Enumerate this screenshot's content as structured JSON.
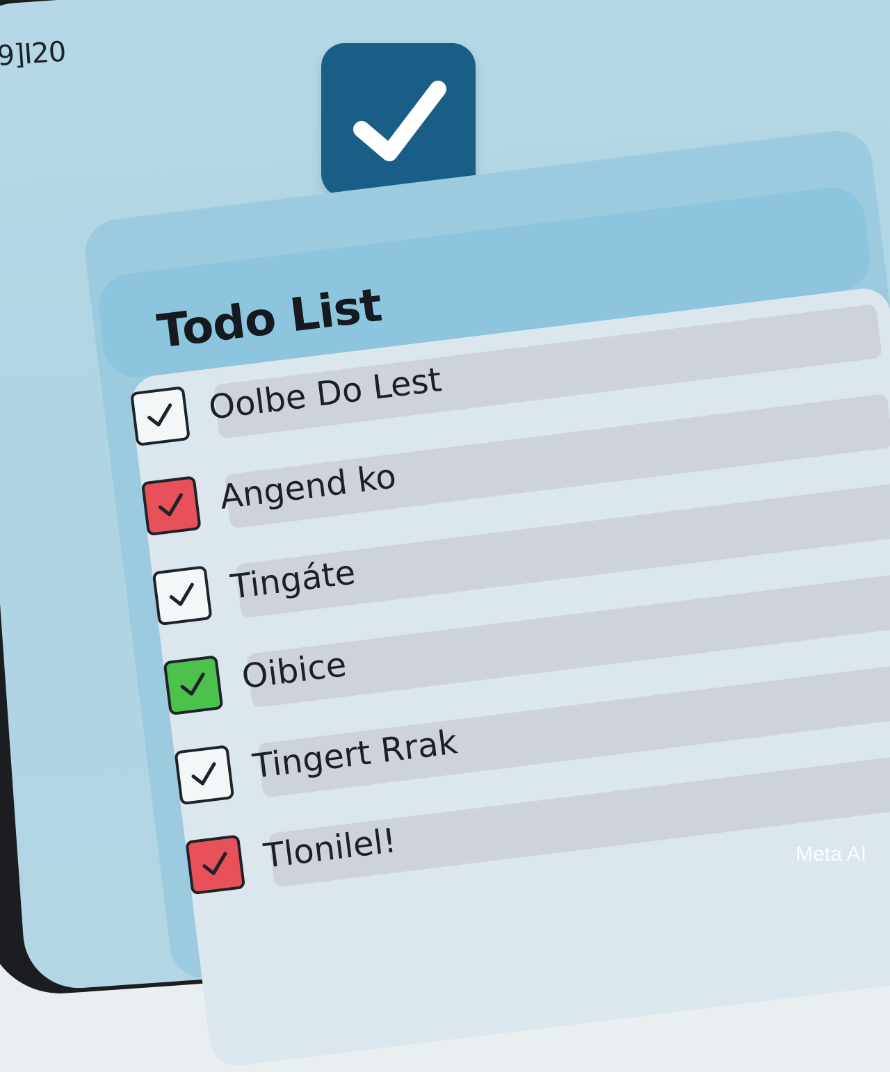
{
  "status_bar": {
    "time": "[9]I20"
  },
  "app": {
    "icon": "checkmark-icon",
    "icon_color": "#195e87",
    "title": "Todo List"
  },
  "tasks": [
    {
      "label": "Oolbe Do Lest",
      "checked": true,
      "color": "default"
    },
    {
      "label": "Angend ko",
      "checked": true,
      "color": "red"
    },
    {
      "label": "Tingáte",
      "checked": true,
      "color": "default"
    },
    {
      "label": "Oibice",
      "checked": true,
      "color": "green"
    },
    {
      "label": "Tingert Rrak",
      "checked": true,
      "color": "default"
    },
    {
      "label": "Tlonilel!",
      "checked": true,
      "color": "red"
    }
  ],
  "colors": {
    "red": "#e8505a",
    "green": "#4cc14c",
    "background": "#b6d8e6"
  },
  "watermark": "Meta AI"
}
